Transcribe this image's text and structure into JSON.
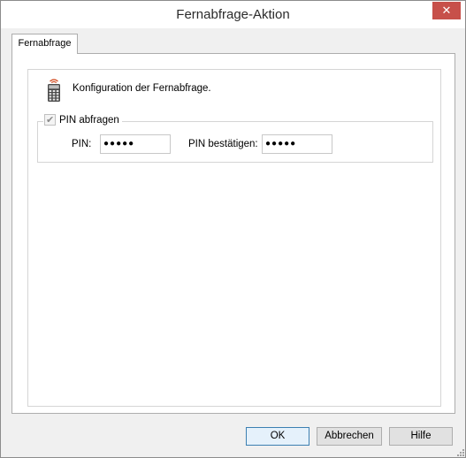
{
  "window": {
    "title": "Fernabfrage-Aktion",
    "close_symbol": "✕"
  },
  "tabs": [
    {
      "label": "Fernabfrage",
      "selected": true
    }
  ],
  "content": {
    "icon": "remote-control-icon",
    "intro_text": "Konfiguration der Fernabfrage."
  },
  "pin_group": {
    "checkbox_label": "PIN abfragen",
    "checkbox_checked": true,
    "checkbox_disabled": true,
    "pin_label": "PIN:",
    "pin_value": "●●●●●",
    "confirm_label": "PIN bestätigen:",
    "confirm_value": "●●●●●"
  },
  "buttons": {
    "ok": "OK",
    "cancel": "Abbrechen",
    "help": "Hilfe"
  },
  "colors": {
    "close_button": "#c7504a",
    "default_button_border": "#3c7fb1"
  }
}
